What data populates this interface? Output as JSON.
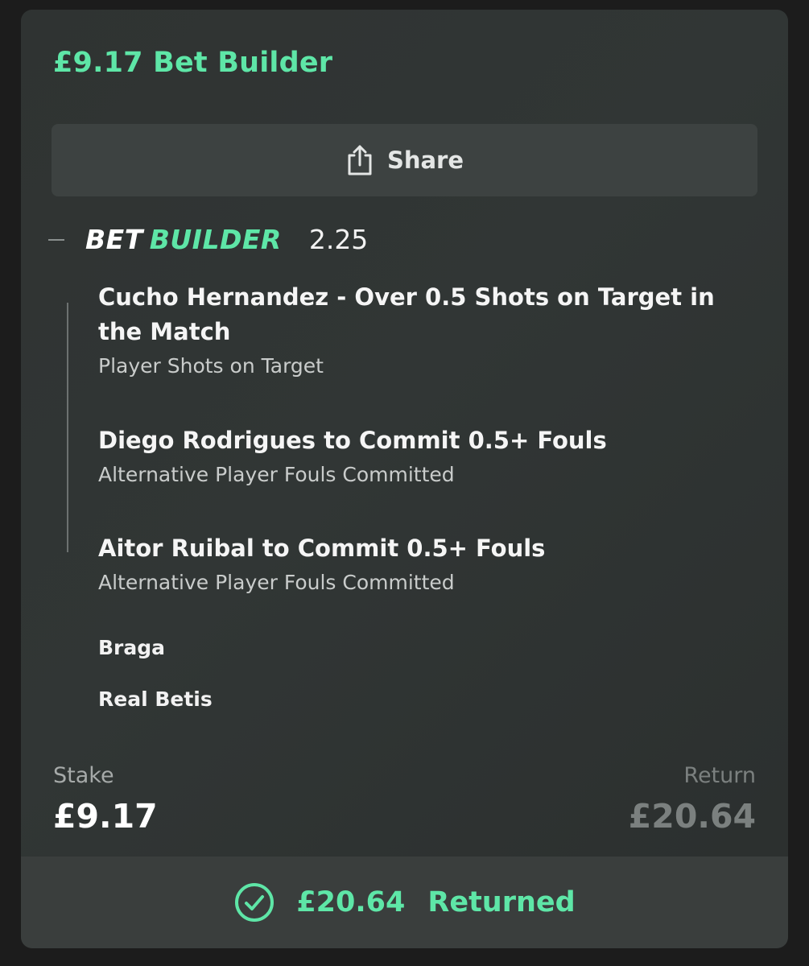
{
  "bet": {
    "title": "£9.17 Bet Builder",
    "share_label": "Share",
    "builder_word1": "BET",
    "builder_word2": "BUILDER",
    "odds": "2.25",
    "selections": [
      {
        "title": "Cucho Hernandez - Over 0.5 Shots on Target in the Match",
        "market": "Player Shots on Target"
      },
      {
        "title": "Diego Rodrigues to Commit 0.5+ Fouls",
        "market": "Alternative Player Fouls Committed"
      },
      {
        "title": "Aitor Ruibal to Commit 0.5+ Fouls",
        "market": "Alternative Player Fouls Committed"
      }
    ],
    "teams": [
      "Braga",
      "Real Betis"
    ],
    "stake_label": "Stake",
    "stake_value": "£9.17",
    "return_label": "Return",
    "return_value": "£20.64",
    "footer_amount": "£20.64",
    "footer_status": "Returned"
  },
  "colors": {
    "accent": "#5ee6a7",
    "card_bg": "#313635",
    "button_bg": "#3d4241",
    "muted": "#7b807f"
  },
  "icons": {
    "share": "share-icon",
    "check": "check-circle-icon",
    "collapse": "minus-icon"
  }
}
